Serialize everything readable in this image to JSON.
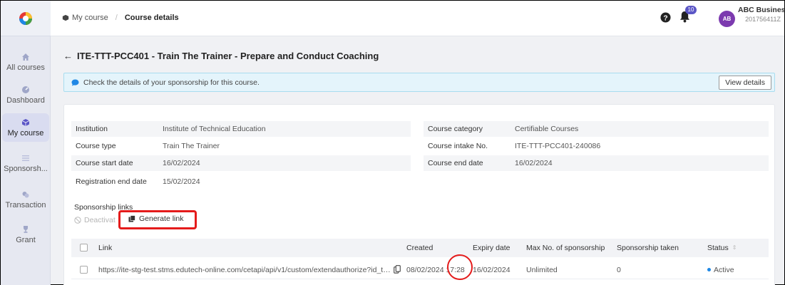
{
  "sidebar": {
    "items": [
      {
        "label": "All courses",
        "icon": "home-icon"
      },
      {
        "label": "Dashboard",
        "icon": "dashboard-icon"
      },
      {
        "label": "My course",
        "icon": "cube-icon",
        "active": true
      },
      {
        "label": "Sponsorsh...",
        "icon": "list-icon"
      },
      {
        "label": "Transaction",
        "icon": "coins-icon"
      },
      {
        "label": "Grant",
        "icon": "trophy-icon"
      }
    ]
  },
  "breadcrumb": {
    "home": "My course",
    "current": "Course details"
  },
  "header": {
    "notifications": "10",
    "avatar_initials": "AB",
    "user_name": "ABC Business",
    "user_id": "201756411Z"
  },
  "page": {
    "title": "ITE-TTT-PCC401 - Train The Trainer - Prepare and Conduct Coaching"
  },
  "notice": {
    "text": "Check the details of your sponsorship for this course.",
    "button": "View details"
  },
  "details": {
    "institution_label": "Institution",
    "institution": "Institute of Technical Education",
    "course_type_label": "Course type",
    "course_type": "Train The Trainer",
    "start_label": "Course start date",
    "start": "16/02/2024",
    "reg_end_label": "Registration end date",
    "reg_end": "15/02/2024",
    "category_label": "Course category",
    "category": "Certifiable Courses",
    "intake_label": "Course intake No.",
    "intake": "ITE-TTT-PCC401-240086",
    "end_label": "Course end date",
    "end": "16/02/2024"
  },
  "links": {
    "section_label": "Sponsorship links",
    "deactivate": "Deactivat",
    "generate": "Generate link",
    "columns": {
      "link": "Link",
      "created": "Created",
      "expiry": "Expiry date",
      "max": "Max No. of sponsorship",
      "taken": "Sponsorship taken",
      "status": "Status"
    },
    "rows": [
      {
        "link": "https://ite-stg-test.stms.edutech-online.com/cetapi/api/v1/custom/extendauthorize?id_toke...",
        "created": "08/02/2024 17:28",
        "expiry": "16/02/2024",
        "max": "Unlimited",
        "taken": "0",
        "status": "Active"
      }
    ]
  },
  "colors": {
    "accent": "#5b56c6",
    "highlight": "#e41b1b",
    "notice_bg": "#e4f4fb",
    "active_status": "#1e88e5"
  }
}
